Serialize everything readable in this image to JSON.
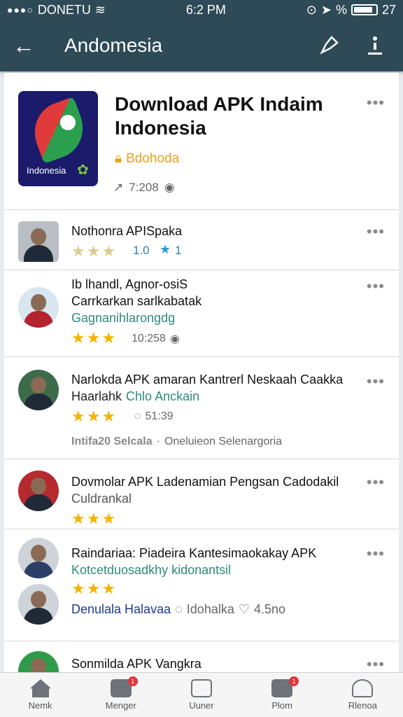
{
  "status_bar": {
    "carrier": "DONETU",
    "time": "6:2 PM",
    "battery": "27"
  },
  "app_bar": {
    "title": "Andomesia"
  },
  "header_app": {
    "name": "Download APK Indaim Indonesia",
    "icon_text": "Indonesia",
    "developer": "Bdohoda",
    "stat": "7:208"
  },
  "items": [
    {
      "title": "Nothonra APISpaka",
      "rating": "1.0",
      "rating_star_count": "1",
      "stars": 3
    },
    {
      "title": "Ib lhandl, Agnor-osiS",
      "title2": "Carrkarkan sarlkabatak",
      "sub": "Gagnanihlarongdg",
      "meta": "10:258",
      "stars": 3
    },
    {
      "title": "Narlokda APK amaran Kantrerl Neskaah Caakka",
      "title2": "Haarlahk",
      "sub": "Chlo Anckain",
      "meta": "51:39",
      "stars": 3,
      "footer_left": "Intifa20 Selcala",
      "footer_right": "Oneluieon Selenargoria"
    },
    {
      "title": "Dovmolar APK Ladenamian Pengsan Cadodakil",
      "sub": "Culdrankal",
      "stars": 3
    },
    {
      "title": "Raindariaa: Piadeira Kantesimaokakay APK",
      "sub": "Kotcetduosadkhy kidonantsil",
      "stars": 3,
      "footer_left": "Denulala Halavaa",
      "footer_mid": "Idohalka",
      "footer_right": "4.5no"
    },
    {
      "title": "Sonmilda APK Vangkra"
    }
  ],
  "bottom_nav": [
    {
      "label": "Nemk",
      "icon": "home-icon"
    },
    {
      "label": "Menger",
      "icon": "messenger-icon",
      "badge": "1"
    },
    {
      "label": "Uuner",
      "icon": "screen-icon"
    },
    {
      "label": "Plom",
      "icon": "pen-icon",
      "badge": "1"
    },
    {
      "label": "Rlenoa",
      "icon": "profile-icon"
    }
  ],
  "colors": {
    "app_bar": "#2e4a57",
    "accent_star": "#f3b400",
    "developer": "#e8a11a"
  }
}
